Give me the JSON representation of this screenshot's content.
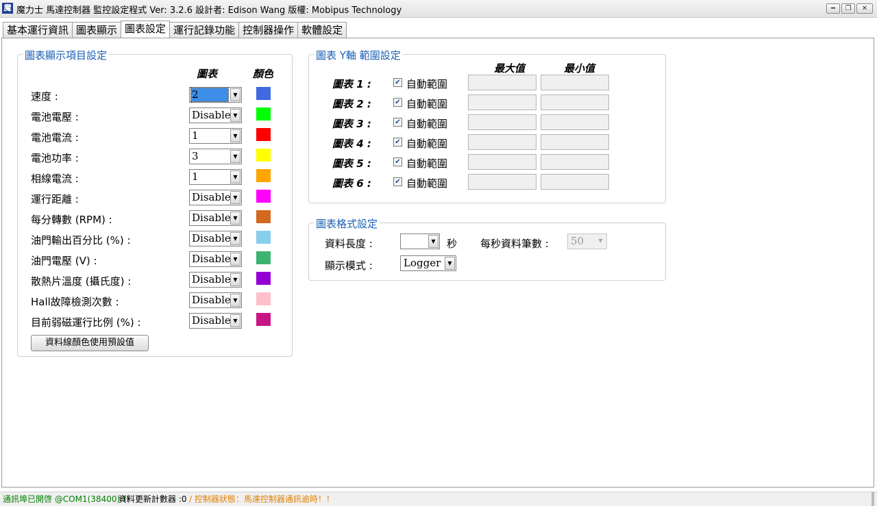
{
  "window": {
    "title": "魔力士 馬達控制器 監控設定程式   Ver: 3.2.6    設計者: Edison Wang  版權: Mobipus  Technology",
    "icon_text": "魔",
    "minimize_icon": "minimize-icon",
    "restore_icon": "restore-icon",
    "close_icon": "close-icon"
  },
  "tabs": [
    {
      "label": "基本運行資訊",
      "active": false
    },
    {
      "label": "圖表顯示",
      "active": false
    },
    {
      "label": "圖表設定",
      "active": true
    },
    {
      "label": "運行記錄功能",
      "active": false
    },
    {
      "label": "控制器操作",
      "active": false
    },
    {
      "label": "軟體設定",
      "active": false
    }
  ],
  "display_settings": {
    "title": "圖表顯示項目設定",
    "header_chart": "圖表",
    "header_color": "顏色",
    "items": [
      {
        "label": "速度 :",
        "chart": "2",
        "color": "#4169e1",
        "selected": true
      },
      {
        "label": "電池電壓 :",
        "chart": "Disable",
        "color": "#00ff00"
      },
      {
        "label": "電池電流 :",
        "chart": "1",
        "color": "#ff0000"
      },
      {
        "label": "電池功率 :",
        "chart": "3",
        "color": "#ffff00"
      },
      {
        "label": "相線電流 :",
        "chart": "1",
        "color": "#ffa500"
      },
      {
        "label": "運行距離 :",
        "chart": "Disable",
        "color": "#ff00ff"
      },
      {
        "label": "每分轉數 (RPM) :",
        "chart": "Disable",
        "color": "#d2691e"
      },
      {
        "label": "油門輸出百分比 (%) :",
        "chart": "Disable",
        "color": "#87ceeb"
      },
      {
        "label": "油門電壓 (V) :",
        "chart": "Disable",
        "color": "#3cb371"
      },
      {
        "label": "散熱片溫度 (攝氏度) :",
        "chart": "Disable",
        "color": "#9400d3"
      },
      {
        "label": "Hall故障檢測次數 :",
        "chart": "Disable",
        "color": "#ffc0cb"
      },
      {
        "label": "目前弱磁運行比例 (%) :",
        "chart": "Disable",
        "color": "#c71585"
      }
    ],
    "reset_colors_button": "資料線顏色使用預設值"
  },
  "y_axis_settings": {
    "title": "圖表 Y軸 範圍設定",
    "header_max": "最大值",
    "header_min": "最小值",
    "rows": [
      {
        "chart": "圖表 1 :",
        "auto_label": "自動範圍",
        "checked": true,
        "max": "",
        "min": ""
      },
      {
        "chart": "圖表 2 :",
        "auto_label": "自動範圍",
        "checked": true,
        "max": "",
        "min": ""
      },
      {
        "chart": "圖表 3 :",
        "auto_label": "自動範圍",
        "checked": true,
        "max": "",
        "min": ""
      },
      {
        "chart": "圖表 4 :",
        "auto_label": "自動範圍",
        "checked": true,
        "max": "",
        "min": ""
      },
      {
        "chart": "圖表 5 :",
        "auto_label": "自動範圍",
        "checked": true,
        "max": "",
        "min": ""
      },
      {
        "chart": "圖表 6 :",
        "auto_label": "自動範圍",
        "checked": true,
        "max": "",
        "min": ""
      }
    ]
  },
  "format_settings": {
    "title": "圖表格式設定",
    "data_length_label": "資料長度 :",
    "data_length_value": "",
    "seconds_unit": "秒",
    "samples_per_second_label": "每秒資料筆數 :",
    "samples_per_second_value": "50",
    "display_mode_label": "顯示模式 :",
    "display_mode_value": "Logger"
  },
  "status_bar": {
    "port_status": "通訊埠已開啓 @COM1(38400) !!",
    "counter": "資料更新計數器 :0",
    "controller_status": "/ 控制器狀態：馬達控制器通訊逾時！！",
    "colors": {
      "port": "#008000",
      "counter": "#000000",
      "controller": "#e08000"
    }
  }
}
